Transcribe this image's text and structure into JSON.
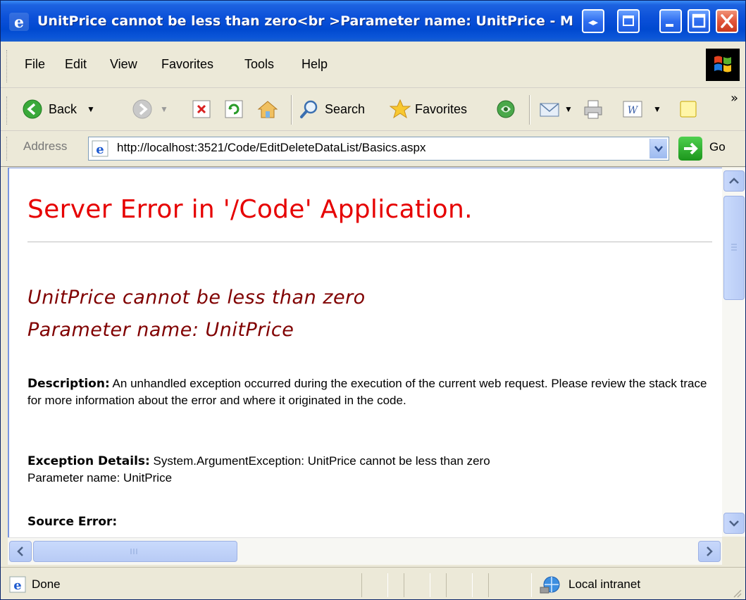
{
  "window": {
    "title": "UnitPrice cannot be less than zero<br >Parameter name: UnitPrice - Microsoft Internet Explorer"
  },
  "menu": {
    "items": [
      "File",
      "Edit",
      "View",
      "Favorites",
      "Tools",
      "Help"
    ]
  },
  "toolbar": {
    "back_label": "Back",
    "search_label": "Search",
    "favorites_label": "Favorites"
  },
  "address": {
    "label": "Address",
    "url": "http://localhost:3521/Code/EditDeleteDataList/Basics.aspx",
    "go_label": "Go"
  },
  "page": {
    "title": "Server Error in '/Code' Application.",
    "error_line1": "UnitPrice cannot be less than zero",
    "error_line2": "Parameter name: UnitPrice",
    "description_label": "Description:",
    "description_text": " An unhandled exception occurred during the execution of the current web request. Please review the stack trace for more information about the error and where it originated in the code.",
    "exception_label": "Exception Details:",
    "exception_text": " System.ArgumentException: UnitPrice cannot be less than zero",
    "exception_text2": "Parameter name: UnitPrice",
    "source_error_label": "Source Error:"
  },
  "status": {
    "text": "Done",
    "zone": "Local intranet"
  }
}
